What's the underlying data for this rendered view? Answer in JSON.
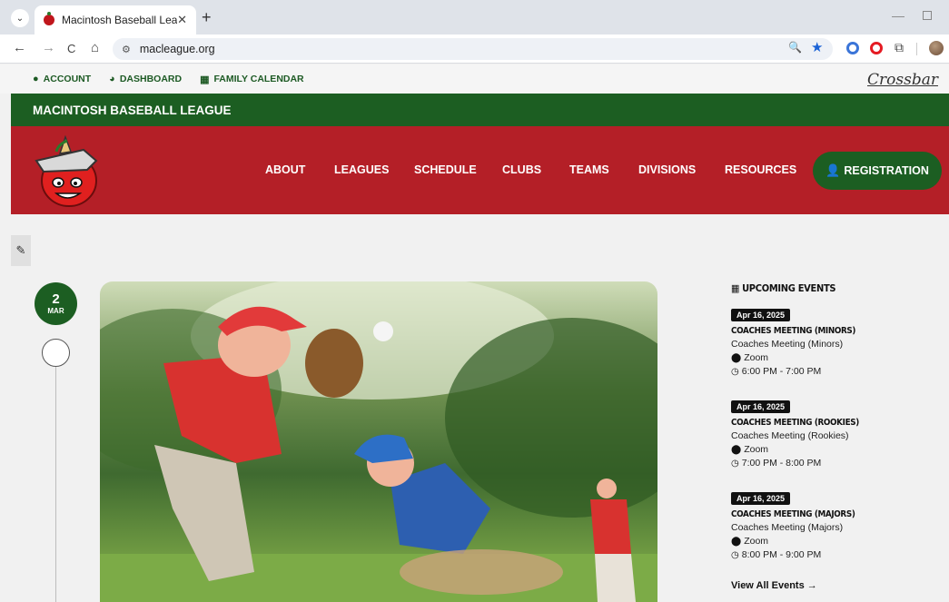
{
  "browser": {
    "tab_title": "Macintosh Baseball League",
    "tab_close": "✕",
    "new_tab": "+",
    "url": "macleague.org",
    "back": "←",
    "forward": "→",
    "reload": "C",
    "home": "⌂",
    "site_info": "⚙",
    "zoom": "🔍",
    "bookmark": "★",
    "minimize": "—",
    "tab_menu": "⌄"
  },
  "utility": {
    "links": [
      {
        "label": "ACCOUNT",
        "icon": "account-icon"
      },
      {
        "label": "DASHBOARD",
        "icon": "dashboard-icon"
      },
      {
        "label": "FAMILY CALENDAR",
        "icon": "calendar-icon"
      }
    ],
    "partner_logo": "Crossbar"
  },
  "league": {
    "name": "MACINTOSH BASEBALL LEAGUE"
  },
  "nav": {
    "items": [
      "ABOUT",
      "LEAGUES",
      "SCHEDULE",
      "CLUBS",
      "TEAMS",
      "DIVISIONS",
      "RESOURCES"
    ],
    "registration": "REGISTRATION"
  },
  "timeline": {
    "day": "2",
    "month": "MAR"
  },
  "events": {
    "title": "UPCOMING EVENTS",
    "items": [
      {
        "date": "Apr 16, 2025",
        "title": "COACHES MEETING (MINORS)",
        "subtitle": "Coaches Meeting (Minors)",
        "location": "Zoom",
        "time": "6:00 PM - 7:00 PM"
      },
      {
        "date": "Apr 16, 2025",
        "title": "COACHES MEETING (ROOKIES)",
        "subtitle": "Coaches Meeting (Rookies)",
        "location": "Zoom",
        "time": "7:00 PM - 8:00 PM"
      },
      {
        "date": "Apr 16, 2025",
        "title": "COACHES MEETING (MAJORS)",
        "subtitle": "Coaches Meeting (Majors)",
        "location": "Zoom",
        "time": "8:00 PM - 9:00 PM"
      }
    ],
    "view_all": "View All Events →"
  },
  "colors": {
    "green": "#1c5e22",
    "red": "#b41f27"
  }
}
